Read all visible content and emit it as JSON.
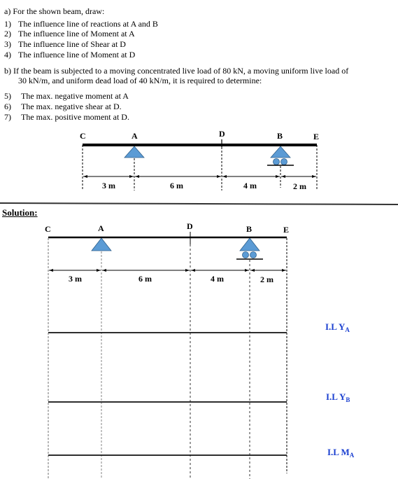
{
  "part_a": {
    "heading": "a)  For the shown beam, draw:",
    "items": [
      {
        "num": "1)",
        "text": "The influence line of reactions at A and B"
      },
      {
        "num": "2)",
        "text": "The influence line of Moment at A"
      },
      {
        "num": "3)",
        "text": "The influence line of Shear at D"
      },
      {
        "num": "4)",
        "text": "The influence line of Moment at D"
      }
    ]
  },
  "part_b": {
    "heading_line1": "b)  If the beam is subjected to a moving concentrated live load of 80 kN, a moving uniform live load of",
    "heading_line2": "30 kN/m, and uniform dead load of 40 kN/m, it is required to determine:",
    "items": [
      {
        "num": "5)",
        "text": "The max. negative moment at A"
      },
      {
        "num": "6)",
        "text": "The max. negative shear at D."
      },
      {
        "num": "7)",
        "text": "The max. positive moment at D."
      }
    ]
  },
  "beam": {
    "points": [
      "C",
      "A",
      "D",
      "B",
      "E"
    ],
    "spans": [
      "3 m",
      "6 m",
      "4 m",
      "2 m"
    ],
    "support_color": "#5b9bd5"
  },
  "solution": {
    "title": "Solution:",
    "influence_lines": [
      {
        "main": "I.L Y",
        "sub": "A"
      },
      {
        "main": "I.L Y",
        "sub": "B"
      },
      {
        "main": "I.L M",
        "sub": "A"
      }
    ],
    "label_color": "#1a3fd0"
  }
}
